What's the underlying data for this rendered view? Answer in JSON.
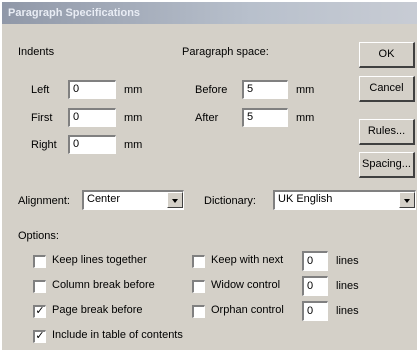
{
  "window": {
    "title": "Paragraph Specifications"
  },
  "indents": {
    "heading": "Indents",
    "left": {
      "label": "Left",
      "value": "0",
      "unit": "mm"
    },
    "first": {
      "label": "First",
      "value": "0",
      "unit": "mm"
    },
    "right": {
      "label": "Right",
      "value": "0",
      "unit": "mm"
    }
  },
  "paragraph_space": {
    "heading": "Paragraph space:",
    "before": {
      "label": "Before",
      "value": "5",
      "unit": "mm"
    },
    "after": {
      "label": "After",
      "value": "5",
      "unit": "mm"
    }
  },
  "buttons": {
    "ok": "OK",
    "cancel": "Cancel",
    "rules": "Rules...",
    "spacing": "Spacing..."
  },
  "alignment": {
    "label": "Alignment:",
    "value": "Center"
  },
  "dictionary": {
    "label": "Dictionary:",
    "value": "UK English"
  },
  "options": {
    "heading": "Options:",
    "keep_lines": {
      "label": "Keep lines together",
      "checked": false
    },
    "column_break": {
      "label": "Column break before",
      "checked": false
    },
    "page_break": {
      "label": "Page break before",
      "checked": true
    },
    "include_toc": {
      "label": "Include in table of contents",
      "checked": true
    },
    "keep_with_next": {
      "label": "Keep with next",
      "checked": false,
      "value": "0",
      "unit": "lines"
    },
    "widow_control": {
      "label": "Widow control",
      "checked": false,
      "value": "0",
      "unit": "lines"
    },
    "orphan_control": {
      "label": "Orphan control",
      "checked": false,
      "value": "0",
      "unit": "lines"
    }
  }
}
